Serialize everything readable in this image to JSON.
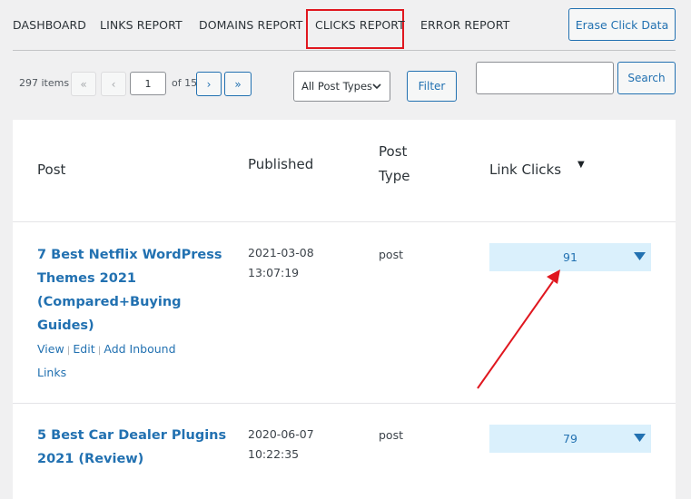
{
  "nav": {
    "tabs": [
      {
        "label": "DASHBOARD"
      },
      {
        "label": "LINKS REPORT"
      },
      {
        "label": "DOMAINS REPORT"
      },
      {
        "label": "CLICKS REPORT",
        "active": true
      },
      {
        "label": "ERROR REPORT"
      }
    ],
    "erase_button": "Erase Click Data"
  },
  "pagination": {
    "items_count": "297 items",
    "first": "«",
    "prev": "‹",
    "current_page": "1",
    "of_pages": "of 15",
    "next": "›",
    "last": "»"
  },
  "filters": {
    "post_type_selected": "All Post Types",
    "filter_button": "Filter",
    "search_value": "",
    "search_button": "Search"
  },
  "table": {
    "headers": {
      "post": "Post",
      "published": "Published",
      "post_type_line1": "Post",
      "post_type_line2": "Type",
      "link_clicks": "Link Clicks"
    },
    "rows": [
      {
        "title_lines": [
          "7 Best Netflix WordPress",
          "Themes 2021",
          "(Compared+Buying",
          "Guides)"
        ],
        "actions": {
          "view": "View",
          "edit": "Edit",
          "add_inbound_1": "Add Inbound",
          "add_inbound_2": "Links"
        },
        "published_date": "2021-03-08",
        "published_time": "13:07:19",
        "post_type": "post",
        "link_clicks": "91"
      },
      {
        "title_lines": [
          "5 Best Car Dealer Plugins",
          "2021 (Review)"
        ],
        "published_date": "2020-06-07",
        "published_time": "10:22:35",
        "post_type": "post",
        "link_clicks": "79"
      }
    ]
  },
  "colors": {
    "accent": "#2271b1",
    "highlight": "#e0171f",
    "clicks_bg": "#daf0fc"
  }
}
